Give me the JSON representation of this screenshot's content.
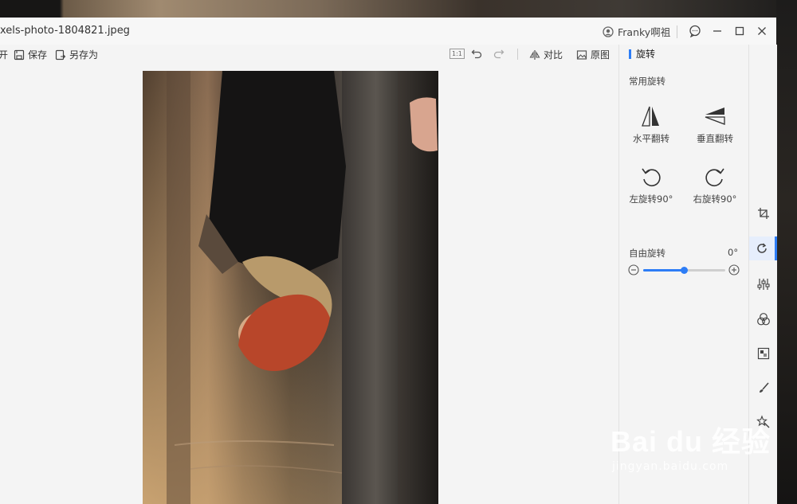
{
  "window": {
    "title": "xels-photo-1804821.jpeg",
    "user_name": "Franky啊祖"
  },
  "toolbar": {
    "open_label": "开",
    "save_label": "保存",
    "save_as_label": "另存为",
    "actual_size_label": "1:1",
    "compare_label": "对比",
    "original_label": "原图"
  },
  "panel": {
    "title": "旋转",
    "common_section": "常用旋转",
    "flip_horizontal": "水平翻转",
    "flip_vertical": "垂直翻转",
    "rotate_left": "左旋转90°",
    "rotate_right": "右旋转90°",
    "free_rotate_label": "自由旋转",
    "free_rotate_value": "0°",
    "slider_fraction": 0.5
  },
  "rail": {
    "items": [
      "crop-icon",
      "rotate-icon",
      "adjust-icon",
      "filter-icon",
      "mosaic-icon",
      "brush-icon",
      "effects-icon"
    ],
    "active": "rotate-icon"
  },
  "watermark": {
    "logo_text": "Bai du 经验",
    "sub_text": "jingyan.baidu.com"
  },
  "colors": {
    "accent": "#2d7df6",
    "window_bg": "#f4f4f4"
  }
}
